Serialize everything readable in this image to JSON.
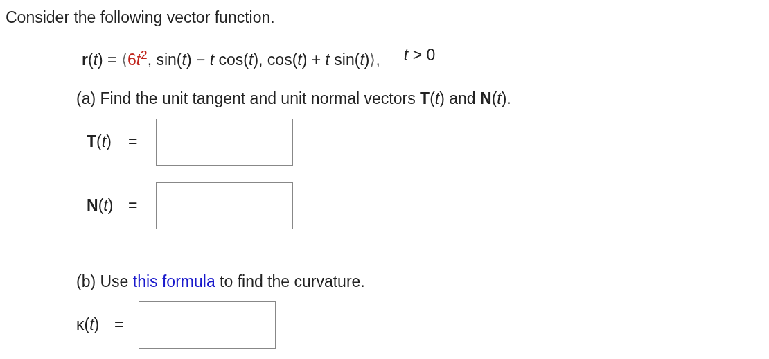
{
  "intro": "Consider the following vector function.",
  "equation": {
    "lhs": "**r**(*t*) =",
    "open": "⟨",
    "highlighted": [
      "6",
      "*t*$^{2}$"
    ],
    "rest": ", sin(*t*) − *t* cos(*t*), cos(*t*) + *t* sin(*t*)",
    "close": "⟩,",
    "condition": "*t* > 0"
  },
  "part_a": {
    "prompt": "(a) Find the unit tangent and unit normal vectors **T**(*t*) and **N**(*t*).",
    "answers": [
      {
        "label": "**T**(*t*)",
        "equals": "="
      },
      {
        "label": "**N**(*t*)",
        "equals": "="
      }
    ]
  },
  "part_b": {
    "before": "(b) Use ",
    "link": "this formula",
    "after": " to find the curvature.",
    "answers": [
      {
        "label": "κ(*t*)",
        "equals": "="
      }
    ]
  }
}
